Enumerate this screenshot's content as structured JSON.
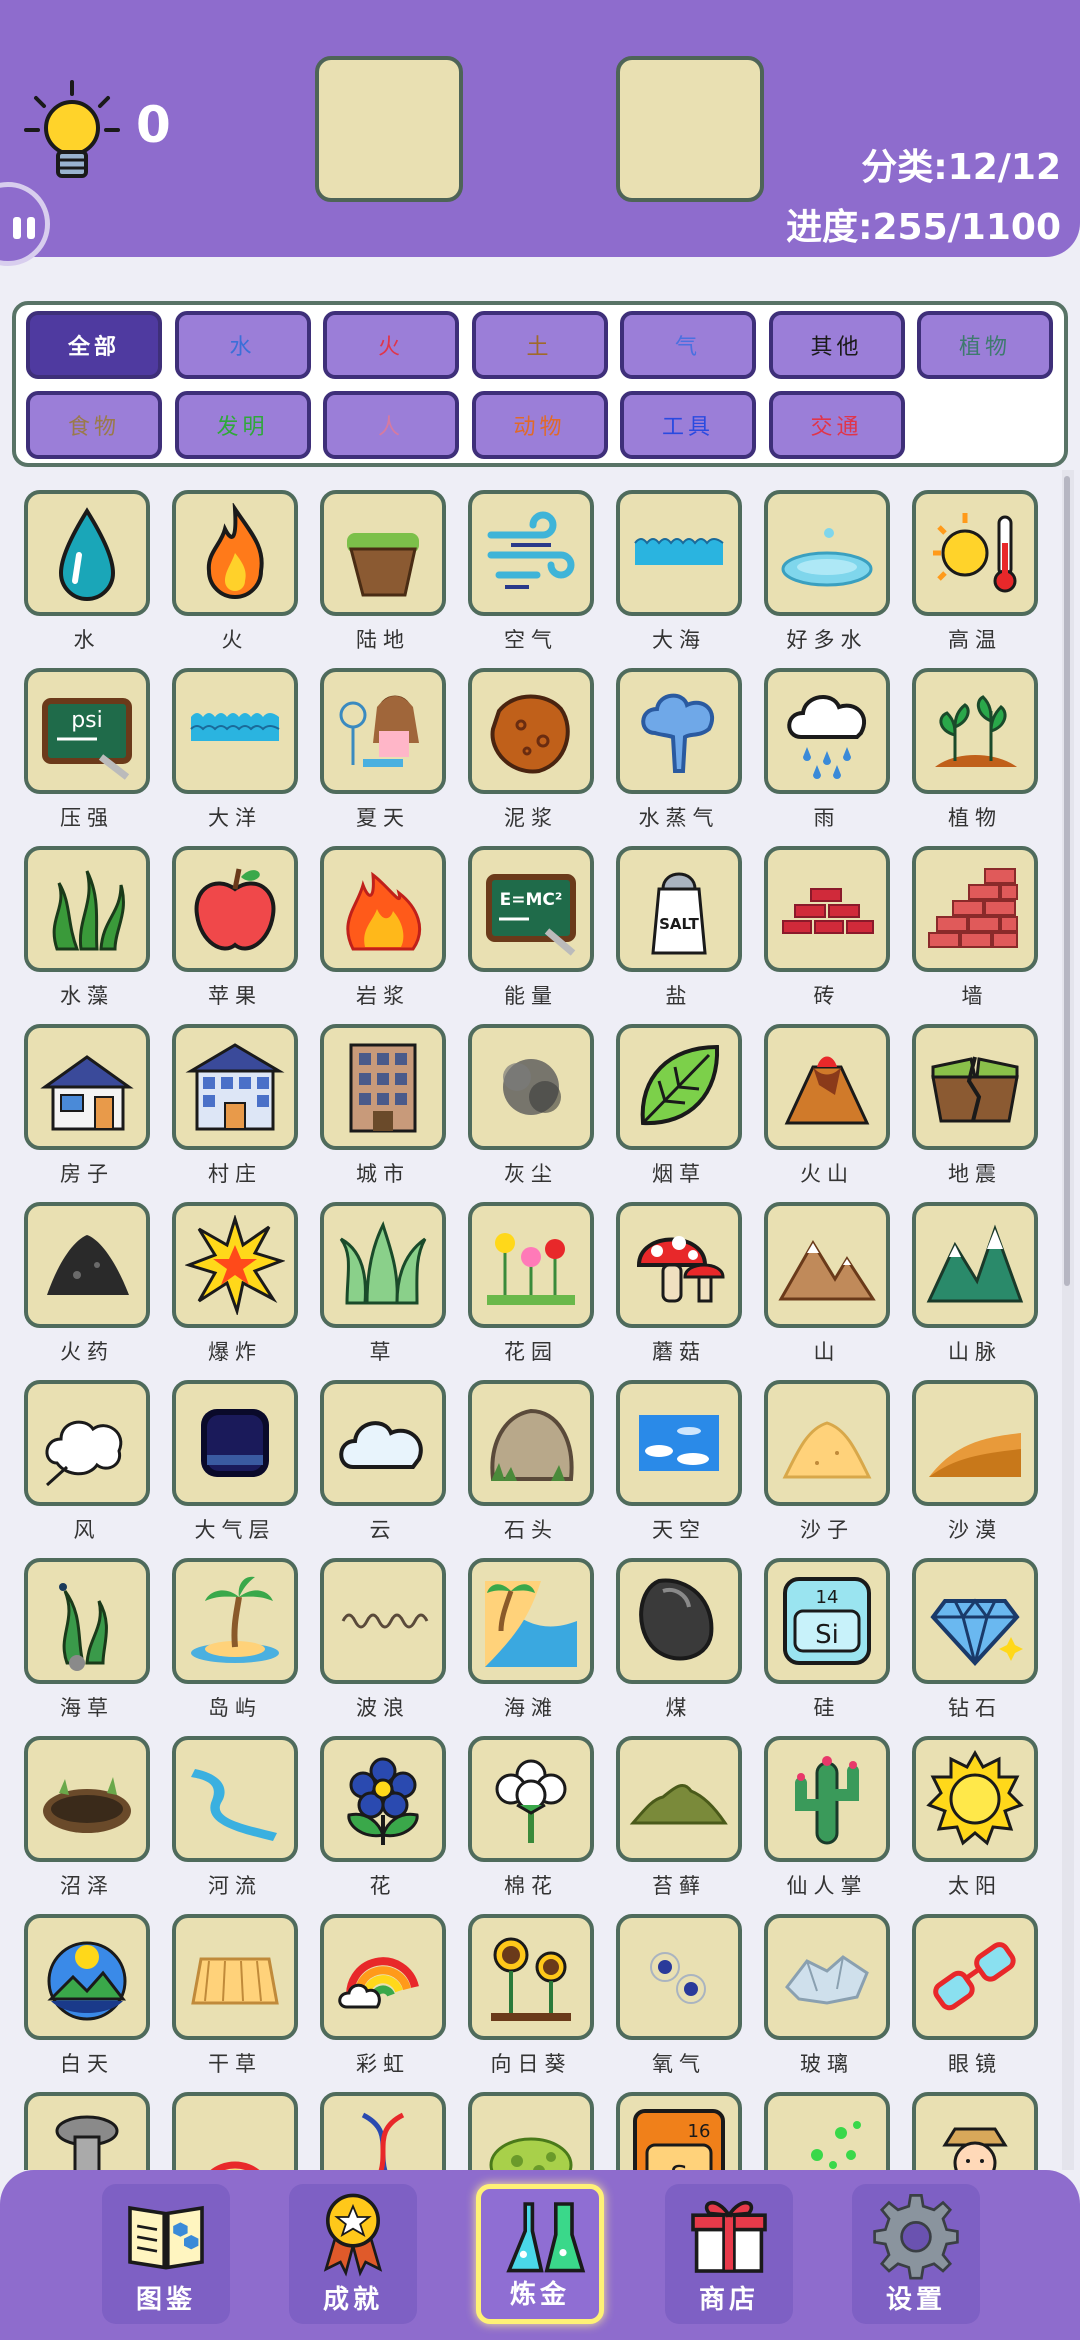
{
  "header": {
    "hint_count": "0",
    "category_status": "分类:12/12",
    "progress_status": "进度:255/1100"
  },
  "filters": [
    {
      "label": "全部",
      "color": "#ffffff",
      "active": true
    },
    {
      "label": "水",
      "color": "#3b6fd8"
    },
    {
      "label": "火",
      "color": "#e0354a"
    },
    {
      "label": "土",
      "color": "#a06a2a"
    },
    {
      "label": "气",
      "color": "#4a70e0"
    },
    {
      "label": "其他",
      "color": "#1a1a1a"
    },
    {
      "label": "植物",
      "color": "#3e7a6e"
    },
    {
      "label": "食物",
      "color": "#9a7a4a"
    },
    {
      "label": "发明",
      "color": "#2fa83a"
    },
    {
      "label": "人",
      "color": "#d67aa0"
    },
    {
      "label": "动物",
      "color": "#e06a2a"
    },
    {
      "label": "工具",
      "color": "#2a4ae0"
    },
    {
      "label": "交通",
      "color": "#e0354a"
    }
  ],
  "items": [
    {
      "label": "水",
      "icon": "water-drop-icon"
    },
    {
      "label": "火",
      "icon": "fire-icon"
    },
    {
      "label": "陆地",
      "icon": "land-icon"
    },
    {
      "label": "空气",
      "icon": "air-icon"
    },
    {
      "label": "大海",
      "icon": "sea-icon"
    },
    {
      "label": "好多水",
      "icon": "puddle-icon"
    },
    {
      "label": "高温",
      "icon": "sun-thermometer-icon"
    },
    {
      "label": "压强",
      "icon": "psi-board-icon"
    },
    {
      "label": "大洋",
      "icon": "ocean-icon"
    },
    {
      "label": "夏天",
      "icon": "summer-girl-icon"
    },
    {
      "label": "泥浆",
      "icon": "mud-icon"
    },
    {
      "label": "水蒸气",
      "icon": "steam-icon"
    },
    {
      "label": "雨",
      "icon": "rain-cloud-icon"
    },
    {
      "label": "植物",
      "icon": "plant-icon"
    },
    {
      "label": "水藻",
      "icon": "algae-icon"
    },
    {
      "label": "苹果",
      "icon": "apple-icon"
    },
    {
      "label": "岩浆",
      "icon": "lava-icon"
    },
    {
      "label": "能量",
      "icon": "emc2-board-icon"
    },
    {
      "label": "盐",
      "icon": "salt-shaker-icon"
    },
    {
      "label": "砖",
      "icon": "bricks-icon"
    },
    {
      "label": "墙",
      "icon": "wall-icon"
    },
    {
      "label": "房子",
      "icon": "house-icon"
    },
    {
      "label": "村庄",
      "icon": "village-building-icon"
    },
    {
      "label": "城市",
      "icon": "city-building-icon"
    },
    {
      "label": "灰尘",
      "icon": "dust-icon"
    },
    {
      "label": "烟草",
      "icon": "tobacco-leaf-icon"
    },
    {
      "label": "火山",
      "icon": "volcano-icon"
    },
    {
      "label": "地震",
      "icon": "earthquake-icon"
    },
    {
      "label": "火药",
      "icon": "gunpowder-icon"
    },
    {
      "label": "爆炸",
      "icon": "explosion-icon"
    },
    {
      "label": "草",
      "icon": "grass-icon"
    },
    {
      "label": "花园",
      "icon": "garden-icon"
    },
    {
      "label": "蘑菇",
      "icon": "mushroom-icon"
    },
    {
      "label": "山",
      "icon": "mountain-icon"
    },
    {
      "label": "山脉",
      "icon": "mountain-range-icon"
    },
    {
      "label": "风",
      "icon": "wind-icon"
    },
    {
      "label": "大气层",
      "icon": "atmosphere-icon"
    },
    {
      "label": "云",
      "icon": "cloud-icon"
    },
    {
      "label": "石头",
      "icon": "stone-icon"
    },
    {
      "label": "天空",
      "icon": "sky-icon"
    },
    {
      "label": "沙子",
      "icon": "sand-icon"
    },
    {
      "label": "沙漠",
      "icon": "desert-icon"
    },
    {
      "label": "海草",
      "icon": "seaweed-icon"
    },
    {
      "label": "岛屿",
      "icon": "island-icon"
    },
    {
      "label": "波浪",
      "icon": "wave-icon"
    },
    {
      "label": "海滩",
      "icon": "beach-icon"
    },
    {
      "label": "煤",
      "icon": "coal-icon"
    },
    {
      "label": "硅",
      "icon": "silicon-icon"
    },
    {
      "label": "钻石",
      "icon": "diamond-icon"
    },
    {
      "label": "沼泽",
      "icon": "swamp-icon"
    },
    {
      "label": "河流",
      "icon": "river-icon"
    },
    {
      "label": "花",
      "icon": "flower-icon"
    },
    {
      "label": "棉花",
      "icon": "cotton-icon"
    },
    {
      "label": "苔藓",
      "icon": "moss-icon"
    },
    {
      "label": "仙人掌",
      "icon": "cactus-icon"
    },
    {
      "label": "太阳",
      "icon": "sun-icon"
    },
    {
      "label": "白天",
      "icon": "daytime-icon"
    },
    {
      "label": "干草",
      "icon": "hay-icon"
    },
    {
      "label": "彩虹",
      "icon": "rainbow-icon"
    },
    {
      "label": "向日葵",
      "icon": "sunflower-icon"
    },
    {
      "label": "氧气",
      "icon": "oxygen-icon"
    },
    {
      "label": "玻璃",
      "icon": "glass-icon"
    },
    {
      "label": "眼镜",
      "icon": "glasses-icon"
    },
    {
      "label": "",
      "icon": "screw-icon"
    },
    {
      "label": "",
      "icon": "double-rainbow-icon"
    },
    {
      "label": "",
      "icon": "dna-icon"
    },
    {
      "label": "",
      "icon": "bacteria-icon"
    },
    {
      "label": "",
      "icon": "sulfur-icon"
    },
    {
      "label": "",
      "icon": "seeds-icon"
    },
    {
      "label": "",
      "icon": "farmer-icon"
    }
  ],
  "nav": [
    {
      "label": "图鉴",
      "icon": "book-icon"
    },
    {
      "label": "成就",
      "icon": "medal-icon"
    },
    {
      "label": "炼金",
      "icon": "flask-icon",
      "active": true
    },
    {
      "label": "商店",
      "icon": "gift-icon"
    },
    {
      "label": "设置",
      "icon": "gear-icon"
    }
  ]
}
